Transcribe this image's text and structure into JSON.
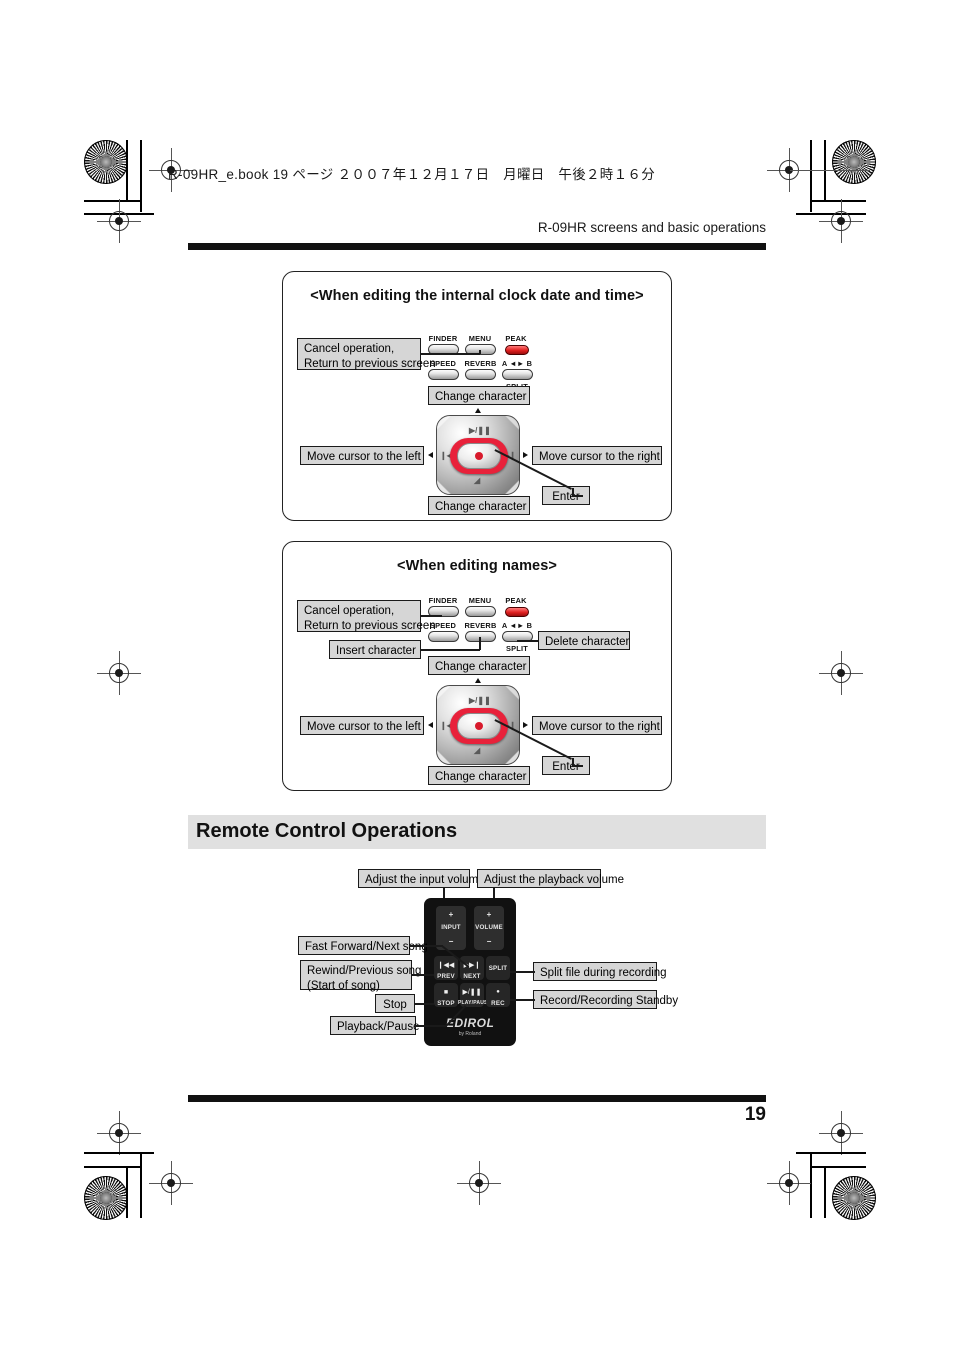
{
  "page": {
    "bookline": "R-09HR_e.book  19 ページ  ２００７年１２月１７日　月曜日　午後２時１６分",
    "running_head": "R-09HR screens and basic operations",
    "page_number": "19"
  },
  "panel1": {
    "title": "<When editing the internal clock date and time>",
    "cancel_label": "Cancel operation,\nReturn to previous screen",
    "change_top": "Change character",
    "change_bottom": "Change character",
    "move_left": "Move cursor to the left",
    "move_right": "Move cursor to the right",
    "enter": "Enter",
    "buttons": {
      "finder": "FINDER",
      "menu": "MENU",
      "peak": "PEAK",
      "speed": "SPEED",
      "reverb": "REVERB",
      "ab": "A ◄► B",
      "split": "SPLIT"
    },
    "pad_glyphs": {
      "play_pause": "▶/❚❚",
      "stop": "◢",
      "prev": "❙◀◀",
      "next": "▶▶❙"
    }
  },
  "panel2": {
    "title": "<When editing names>",
    "cancel_label": "Cancel operation,\nReturn to previous screen",
    "insert": "Insert character",
    "delete": "Delete character",
    "change_top": "Change character",
    "change_bottom": "Change character",
    "move_left": "Move cursor to the left",
    "move_right": "Move cursor to the right",
    "enter": "Enter",
    "buttons": {
      "finder": "FINDER",
      "menu": "MENU",
      "peak": "PEAK",
      "speed": "SPEED",
      "reverb": "REVERB",
      "ab": "A ◄► B",
      "split": "SPLIT"
    }
  },
  "section": {
    "heading": "Remote Control Operations"
  },
  "remote": {
    "callouts": {
      "input_volume": "Adjust the input volume",
      "playback_volume": "Adjust the playback volume",
      "ff_next": "Fast Forward/Next song",
      "rew_prev": "Rewind/Previous song\n(Start of song)",
      "stop": "Stop",
      "play_pause": "Playback/Pause",
      "split": "Split file during recording",
      "record": "Record/Recording Standby"
    },
    "buttons": {
      "input": "INPUT",
      "volume": "VOLUME",
      "plus": "+",
      "minus": "−",
      "prev": "PREV",
      "next": "NEXT",
      "split": "SPLIT",
      "stop": "STOP",
      "play_pause": "PLAY/PAUSE",
      "rec": "REC"
    },
    "symbols": {
      "prev": "❙◀◀",
      "next": "▶▶❙",
      "split": "SPLIT",
      "stop": "■",
      "play_pause": "▶/❚❚",
      "rec": "●"
    },
    "logo": "EDIROL",
    "logo_sub": "by Roland"
  }
}
